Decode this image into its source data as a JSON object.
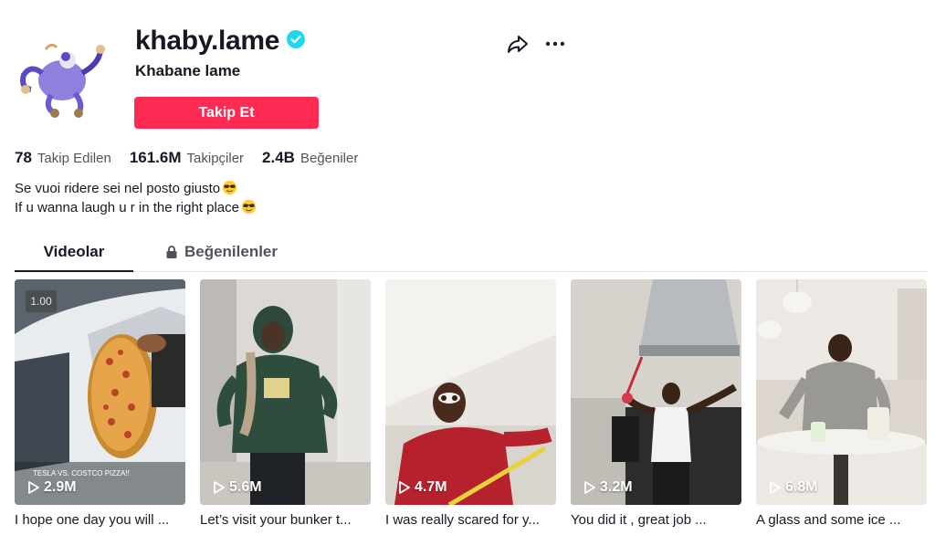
{
  "profile": {
    "username": "khaby.lame",
    "nickname": "Khabane lame",
    "follow_label": "Takip Et",
    "verified": true,
    "accent_color": "#fe2c55",
    "verified_color": "#20d5ec"
  },
  "stats": [
    {
      "value": "78",
      "label": "Takip Edilen"
    },
    {
      "value": "161.6M",
      "label": "Takipçiler"
    },
    {
      "value": "2.4B",
      "label": "Beğeniler"
    }
  ],
  "bio": {
    "line1": "Se vuoi ridere sei nel posto giusto",
    "line2": "If u wanna laugh u r in the right place",
    "emoji": "smiling-face-with-sunglasses"
  },
  "tabs": {
    "videos": "Videolar",
    "liked": "Beğenilenler"
  },
  "videos": [
    {
      "views": "2.9M",
      "caption": "I hope one day you will ...",
      "overlay": "TESLA VS. COSTCO PIZZA!!",
      "timer": "1.00"
    },
    {
      "views": "5.6M",
      "caption": "Let’s visit your bunker t..."
    },
    {
      "views": "4.7M",
      "caption": "I was really scared for y..."
    },
    {
      "views": "3.2M",
      "caption": "You did it , great job ..."
    },
    {
      "views": "6.8M",
      "caption": "A glass and some ice ..."
    }
  ],
  "icons": [
    "share-icon",
    "more-icon",
    "verified-icon",
    "lock-icon",
    "play-icon"
  ]
}
